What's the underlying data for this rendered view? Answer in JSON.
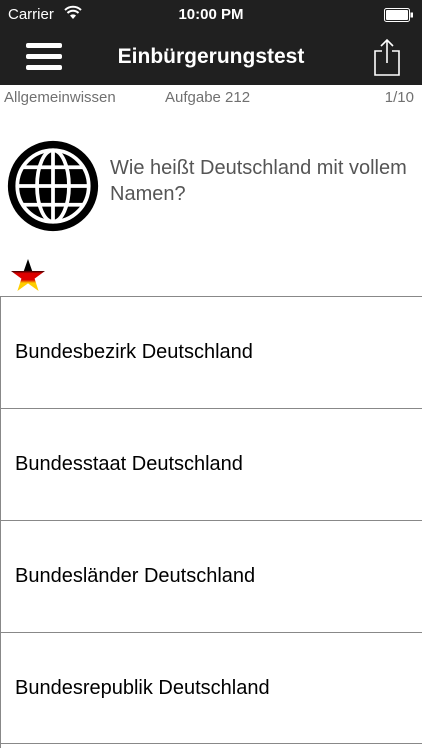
{
  "status": {
    "carrier": "Carrier",
    "time": "10:00 PM"
  },
  "nav": {
    "title": "Einbürgerungstest",
    "menu_icon": "hamburger-menu-icon",
    "share_icon": "share-icon"
  },
  "info": {
    "category": "Allgemeinwissen",
    "task": "Aufgabe 212",
    "progress": "1/10"
  },
  "question": {
    "icon": "globe-icon",
    "text": "Wie heißt Deutschland mit vollem Namen?"
  },
  "badge": {
    "icon": "german-flag-star-icon",
    "colors": [
      "#000000",
      "#dd0000",
      "#ffce00"
    ]
  },
  "answers": [
    {
      "label": "Bundesbezirk Deutschland"
    },
    {
      "label": "Bundesstaat Deutschland"
    },
    {
      "label": "Bundesländer Deutschland"
    },
    {
      "label": "Bundesrepublik Deutschland"
    }
  ]
}
